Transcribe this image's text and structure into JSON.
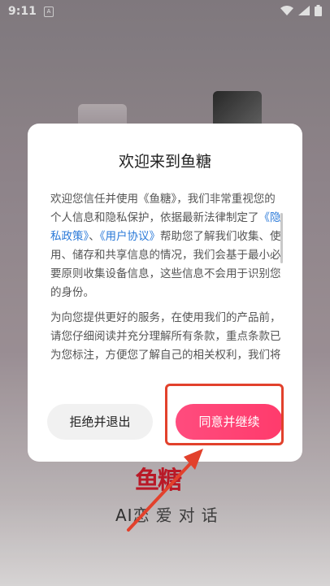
{
  "status_bar": {
    "time": "9:11",
    "badge": "A",
    "icons": [
      "wifi-icon",
      "signal-icon",
      "battery-icon"
    ]
  },
  "background": {
    "logo": "鱼糖",
    "tagline_ai": "AI",
    "tagline_rest": "恋爱对话"
  },
  "dialog": {
    "title": "欢迎来到鱼糖",
    "p1_a": "欢迎您信任并使用《鱼糖》，我们非常重视您的个人信息和隐私保护，依据最新法律制定了",
    "privacy_link": "《隐私政策》",
    "sep": "、",
    "terms_link": "《用户协议》",
    "p1_b": "帮助您了解我们收集、使用、储存和共享信息的情况，我们会基于最小必要原则收集设备信息，这些信息不会用于识别您的身份。",
    "p2": "为向您提供更好的服务，在使用我们的产品前，请您仔细阅读并充分理解所有条款，重点条款已为您标注，方便您了解自己的相关权利，我们将通过《隐私政策》向您说明：",
    "decline_label": "拒绝并退出",
    "agree_label": "同意并继续"
  },
  "colors": {
    "accent": "#ff3b6c",
    "link": "#2a79d8",
    "highlight": "#e2412c"
  }
}
